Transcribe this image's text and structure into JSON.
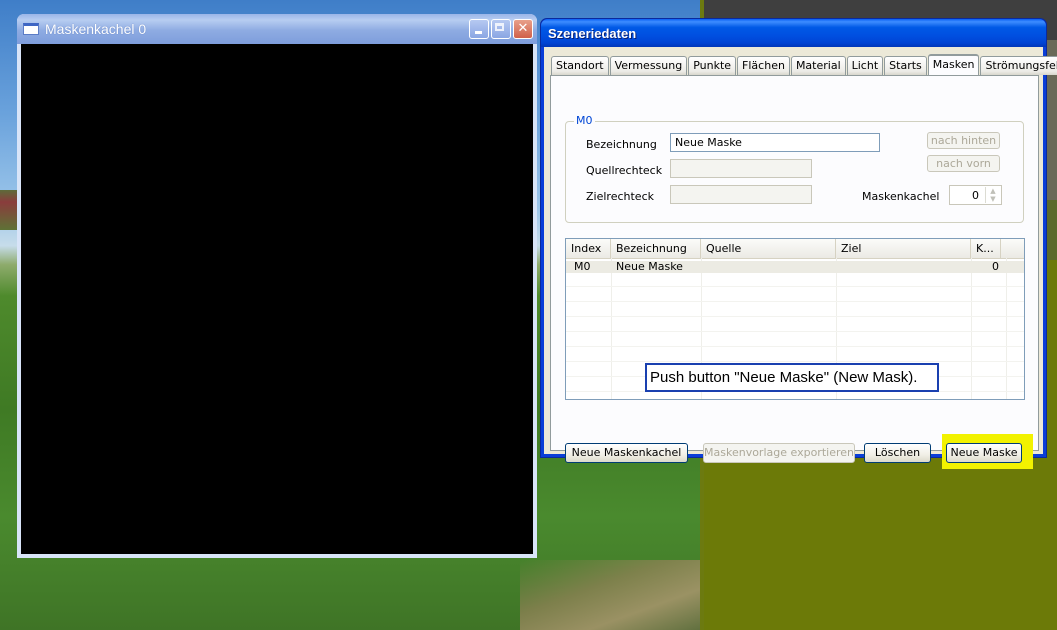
{
  "mask_tile_window": {
    "title": "Maskenkachel 0"
  },
  "dialog": {
    "title": "Szeneriedaten",
    "tabs": [
      "Standort",
      "Vermessung",
      "Punkte",
      "Flächen",
      "Material",
      "Licht",
      "Starts",
      "Masken",
      "Strömungsfeld"
    ],
    "active_tab": "Masken",
    "group": {
      "label": "M0",
      "bezeichnung_label": "Bezeichnung",
      "bezeichnung_value": "Neue Maske",
      "quellrechteck_label": "Quellrechteck",
      "quellrechteck_value": "",
      "zielrechteck_label": "Zielrechteck",
      "zielrechteck_value": "",
      "btn_back": "nach hinten",
      "btn_front": "nach vorn",
      "maskenkachel_label": "Maskenkachel",
      "maskenkachel_value": "0"
    },
    "table": {
      "columns": [
        "Index",
        "Bezeichnung",
        "Quelle",
        "Ziel",
        "K..."
      ],
      "rows": [
        {
          "index": "M0",
          "bezeichnung": "Neue Maske",
          "quelle": "",
          "ziel": "",
          "k": "0"
        }
      ]
    },
    "tooltip": "Push button \"Neue Maske\" (New Mask).",
    "buttons": {
      "new_tile": "Neue Maskenkachel",
      "export_template": "Maskenvorlage exportieren",
      "delete": "Löschen",
      "new_mask": "Neue Maske"
    }
  },
  "colors": {
    "highlight": "#f2f200",
    "xp_blue": "#0a3ed8",
    "olive_background": "#6c7a08"
  }
}
